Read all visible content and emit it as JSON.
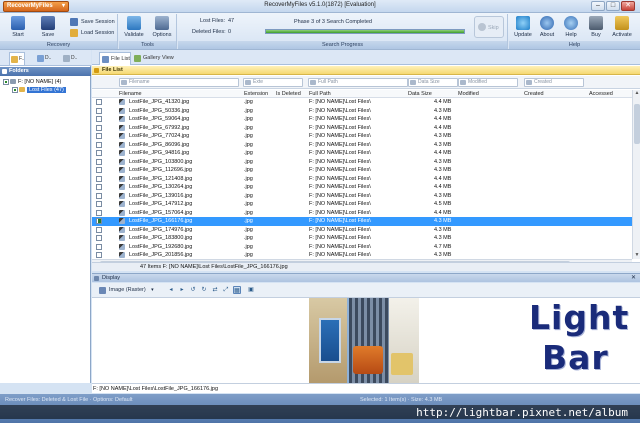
{
  "window": {
    "app_menu": "RecoverMyFiles",
    "title": "RecoverMyFiles v5.1.0(1872) [Evaluation]",
    "controls": {
      "minimize": "–",
      "maximize": "□",
      "close": "✕"
    }
  },
  "ribbon": {
    "recovery": {
      "label": "Recovery",
      "start": "Start",
      "save": "Save",
      "save_session": "Save Session",
      "load_session": "Load Session"
    },
    "tools": {
      "label": "Tools",
      "validate": "Validate",
      "options": "Options"
    },
    "search_progress": {
      "label": "Search Progress",
      "lost_files_label": "Lost Files:",
      "lost_files_value": "47",
      "deleted_files_label": "Deleted Files:",
      "deleted_files_value": "0",
      "phase_text": "Phase 3 of 3 Search Completed",
      "progress": 1.0,
      "skip": "Skip"
    },
    "help": {
      "label": "Help",
      "update": "Update",
      "about": "About",
      "help": "Help",
      "buy": "Buy",
      "activate": "Activate"
    }
  },
  "left_tabs": [
    "F..",
    "D..",
    "D.."
  ],
  "folders": {
    "header": "Folders",
    "tree": [
      {
        "label": "F: [NO NAME] (4)"
      },
      {
        "label": "Lost Files (47)"
      }
    ]
  },
  "main_tabs": {
    "file_list": "File List",
    "gallery": "Gallery View"
  },
  "file_list_header": "File List",
  "filters": {
    "filename": "Filename",
    "ext": "Exte",
    "full_path": "Full Path",
    "data_size": "Data Size",
    "modified": "Modified",
    "created": "Created"
  },
  "columns": {
    "filename": "Filename",
    "extension": "Extension",
    "is_deleted": "Is Deleted",
    "full_path": "Full Path",
    "data_size": "Data Size",
    "modified": "Modified",
    "created": "Created",
    "accessed": "Accessed"
  },
  "rows": [
    {
      "name": "LostFile_JPG_41320.jpg",
      "ext": ".jpg",
      "path": "F: [NO NAME]\\Lost Files\\",
      "size": "4.4 MB",
      "checked": false,
      "selected": false
    },
    {
      "name": "LostFile_JPG_50336.jpg",
      "ext": ".jpg",
      "path": "F: [NO NAME]\\Lost Files\\",
      "size": "4.3 MB",
      "checked": false,
      "selected": false
    },
    {
      "name": "LostFile_JPG_59064.jpg",
      "ext": ".jpg",
      "path": "F: [NO NAME]\\Lost Files\\",
      "size": "4.4 MB",
      "checked": false,
      "selected": false
    },
    {
      "name": "LostFile_JPG_67992.jpg",
      "ext": ".jpg",
      "path": "F: [NO NAME]\\Lost Files\\",
      "size": "4.4 MB",
      "checked": false,
      "selected": false
    },
    {
      "name": "LostFile_JPG_77024.jpg",
      "ext": ".jpg",
      "path": "F: [NO NAME]\\Lost Files\\",
      "size": "4.3 MB",
      "checked": false,
      "selected": false
    },
    {
      "name": "LostFile_JPG_86096.jpg",
      "ext": ".jpg",
      "path": "F: [NO NAME]\\Lost Files\\",
      "size": "4.3 MB",
      "checked": false,
      "selected": false
    },
    {
      "name": "LostFile_JPG_94816.jpg",
      "ext": ".jpg",
      "path": "F: [NO NAME]\\Lost Files\\",
      "size": "4.4 MB",
      "checked": false,
      "selected": false
    },
    {
      "name": "LostFile_JPG_103800.jpg",
      "ext": ".jpg",
      "path": "F: [NO NAME]\\Lost Files\\",
      "size": "4.3 MB",
      "checked": false,
      "selected": false
    },
    {
      "name": "LostFile_JPG_112696.jpg",
      "ext": ".jpg",
      "path": "F: [NO NAME]\\Lost Files\\",
      "size": "4.3 MB",
      "checked": false,
      "selected": false
    },
    {
      "name": "LostFile_JPG_121408.jpg",
      "ext": ".jpg",
      "path": "F: [NO NAME]\\Lost Files\\",
      "size": "4.4 MB",
      "checked": false,
      "selected": false
    },
    {
      "name": "LostFile_JPG_130264.jpg",
      "ext": ".jpg",
      "path": "F: [NO NAME]\\Lost Files\\",
      "size": "4.4 MB",
      "checked": false,
      "selected": false
    },
    {
      "name": "LostFile_JPG_139016.jpg",
      "ext": ".jpg",
      "path": "F: [NO NAME]\\Lost Files\\",
      "size": "4.3 MB",
      "checked": false,
      "selected": false
    },
    {
      "name": "LostFile_JPG_147912.jpg",
      "ext": ".jpg",
      "path": "F: [NO NAME]\\Lost Files\\",
      "size": "4.5 MB",
      "checked": false,
      "selected": false
    },
    {
      "name": "LostFile_JPG_157064.jpg",
      "ext": ".jpg",
      "path": "F: [NO NAME]\\Lost Files\\",
      "size": "4.4 MB",
      "checked": false,
      "selected": false
    },
    {
      "name": "LostFile_JPG_166176.jpg",
      "ext": ".jpg",
      "path": "F: [NO NAME]\\Lost Files\\",
      "size": "4.3 MB",
      "checked": true,
      "selected": true
    },
    {
      "name": "LostFile_JPG_174976.jpg",
      "ext": ".jpg",
      "path": "F: [NO NAME]\\Lost Files\\",
      "size": "4.3 MB",
      "checked": false,
      "selected": false
    },
    {
      "name": "LostFile_JPG_183800.jpg",
      "ext": ".jpg",
      "path": "F: [NO NAME]\\Lost Files\\",
      "size": "4.3 MB",
      "checked": false,
      "selected": false
    },
    {
      "name": "LostFile_JPG_192680.jpg",
      "ext": ".jpg",
      "path": "F: [NO NAME]\\Lost Files\\",
      "size": "4.7 MB",
      "checked": false,
      "selected": false
    },
    {
      "name": "LostFile_JPG_201856.jpg",
      "ext": ".jpg",
      "path": "F: [NO NAME]\\Lost Files\\",
      "size": "4.3 MB",
      "checked": false,
      "selected": false
    }
  ],
  "summary": "47 Items  F: [NO NAME]\\Lost Files\\LostFile_JPG_166176.jpg",
  "display": {
    "header": "Display",
    "close": "✕",
    "mode": "Image (Raster)"
  },
  "logo": {
    "line1": "Light",
    "line2": "Bar"
  },
  "path_bar": "F: [NO NAME]\\Lost Files\\LostFile_JPG_166176.jpg",
  "statusbar": {
    "left": "Recover Files: Deleted & Lost File  ·  Options: Default",
    "right": "Selected: 1 Item(s)  ·  Size: 4.3 MB"
  },
  "watermark": "http://lightbar.pixnet.net/album",
  "colors": {
    "accent": "#3399ff",
    "progress": "#3f9d2c",
    "logo": "#1a2b7a"
  }
}
